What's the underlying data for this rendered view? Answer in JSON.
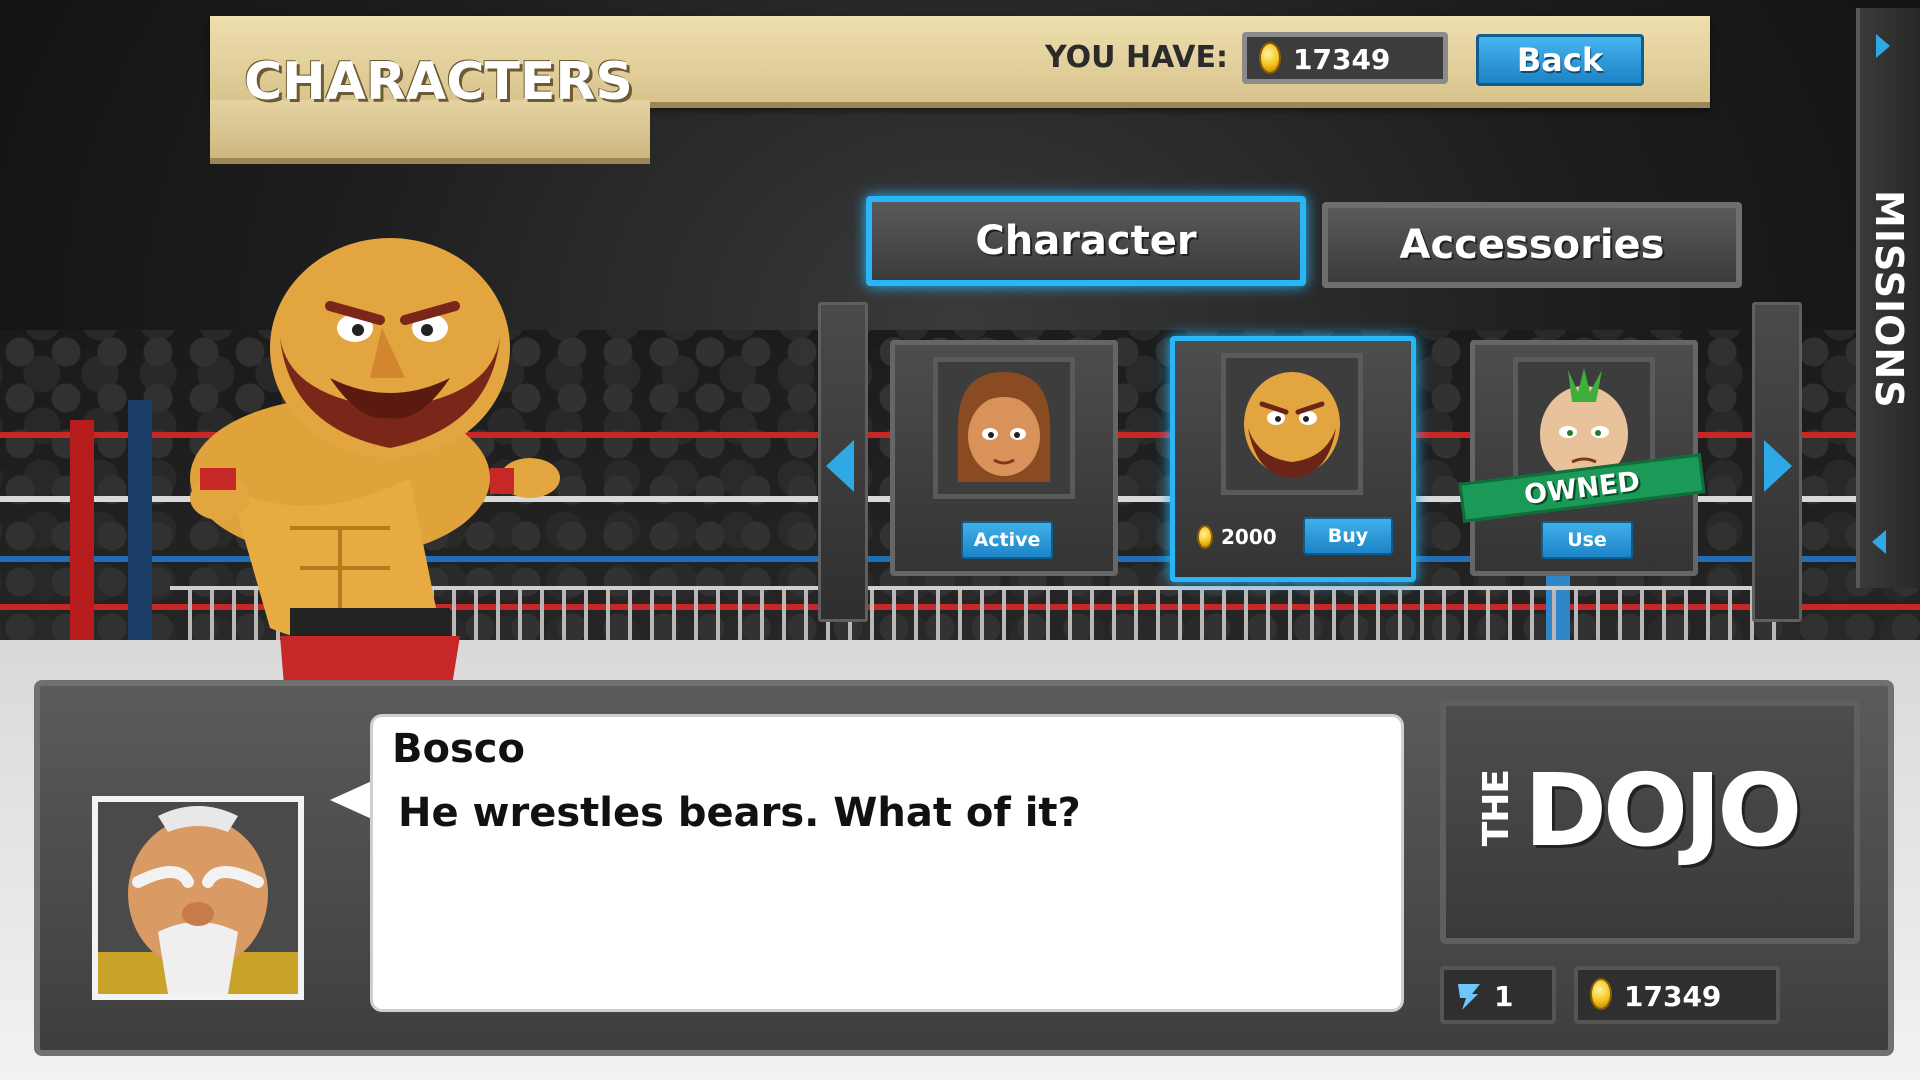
{
  "header": {
    "title": "CHARACTERS",
    "you_have_label": "YOU HAVE:",
    "coins": "17349",
    "back_label": "Back"
  },
  "side_tab": {
    "label": "MISSIONS"
  },
  "tabs": [
    {
      "label": "Character",
      "active": true
    },
    {
      "label": "Accessories",
      "active": false
    }
  ],
  "cards": [
    {
      "name": "brown-hair-girl",
      "button": "Active",
      "state": "active"
    },
    {
      "name": "bosco",
      "price": "2000",
      "button": "Buy",
      "state": "selected"
    },
    {
      "name": "green-mohawk-wrestler",
      "button": "Use",
      "banner": "OWNED",
      "state": "owned"
    }
  ],
  "dialog": {
    "speaker": "Bosco",
    "text": "He wrestles bears. What of it?"
  },
  "logo": {
    "the": "THE",
    "main": "DOJO"
  },
  "stats": {
    "energy": "1",
    "coins": "17349"
  },
  "colors": {
    "accent": "#29b6f6",
    "button": "#1d84c8",
    "owned": "#1a9a56",
    "plank": "#e3d09c"
  }
}
